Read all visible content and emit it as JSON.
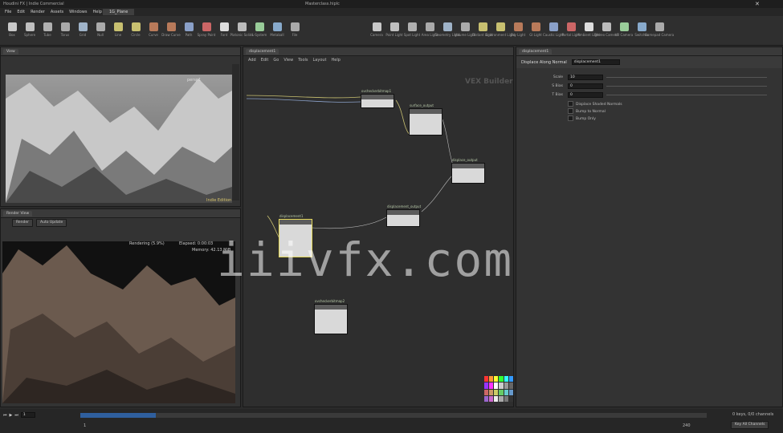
{
  "window": {
    "title_fragment": "Houdini FX | Indie Commercial",
    "tab_file": "Masterclass.hiplc"
  },
  "menu": [
    "File",
    "Edit",
    "Render",
    "Assets",
    "Windows",
    "Help"
  ],
  "main_tab": "1G_Plane",
  "shelf_left": [
    "Box",
    "Sphere",
    "Tube",
    "Torus",
    "Grid",
    "Null",
    "Line",
    "Circle",
    "Curve",
    "Draw Curve",
    "Path",
    "Spray Paint",
    "Font",
    "Platonic Solids",
    "L-System",
    "Metaball",
    "File"
  ],
  "shelf_right": [
    "Camera",
    "Point Light",
    "Spot Light",
    "Area Light",
    "Geometry Light",
    "Volume Light",
    "Distant Light",
    "Environment Light",
    "Sky Light",
    "GI Light",
    "Caustic Light",
    "Portal Light",
    "Ambient Light",
    "Stereo Camera",
    "VR Camera",
    "Switcher",
    "Gamepad Camera"
  ],
  "viewport": {
    "label": "View",
    "badge": "Indie Edition",
    "persp": "persp1"
  },
  "render_view": {
    "status": "Rendering (5.9%)",
    "elapsed": "Elapsed: 0:00:03",
    "memory": "Memory: 42.13 MiB",
    "button": "Render",
    "snapshot": "Auto Update"
  },
  "network": {
    "path": "displacement1",
    "context": "VEX Builder",
    "nodes": [
      {
        "name": "ovcheckerbitmap1"
      },
      {
        "name": "surface_output"
      },
      {
        "name": "displace_output"
      },
      {
        "name": "displacement_output"
      },
      {
        "name": "displacement1"
      },
      {
        "name": "ovcheckerbitmap2"
      }
    ],
    "menu": [
      "Add",
      "Edit",
      "Go",
      "View",
      "Tools",
      "Layout",
      "Help"
    ]
  },
  "params": {
    "header": "Displacement",
    "node_type": "Displace Along Normal",
    "node_name": "displacement1",
    "rows": [
      {
        "label": "Scale",
        "value": "10"
      },
      {
        "label": "S Bias",
        "value": "0"
      },
      {
        "label": "T Bias",
        "value": "0"
      }
    ],
    "toggles": [
      "Displace Shaded Normals",
      "Bump to Normal",
      "Bump Only"
    ]
  },
  "timeline": {
    "frame": "1",
    "start": "1",
    "end": "240",
    "auto_update": "Auto Update",
    "keys_label": "0 keys, 0/0 channels",
    "key_all": "Key All Channels"
  },
  "watermark": "iiivfx.com",
  "colors": {
    "accent_green": "#b7c9a8",
    "node_body": "#d9d9d9",
    "wire": "#c8c070",
    "wire_blue": "#8aa0c8"
  }
}
